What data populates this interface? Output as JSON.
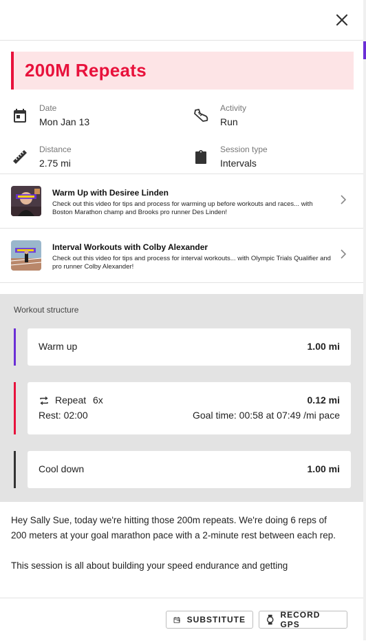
{
  "workout": {
    "title": "200M Repeats"
  },
  "meta": {
    "date": {
      "label": "Date",
      "value": "Mon Jan 13",
      "icon": "calendar-icon"
    },
    "activity": {
      "label": "Activity",
      "value": "Run",
      "icon": "running-shoe-icon"
    },
    "distance": {
      "label": "Distance",
      "value": "2.75 mi",
      "icon": "ruler-icon"
    },
    "session_type": {
      "label": "Session type",
      "value": "Intervals",
      "icon": "clipboard-icon"
    }
  },
  "videos": [
    {
      "title": "Warm Up with Desiree Linden",
      "description": "Check out this video for tips and process for warming up before workouts and races... with Boston Marathon champ and Brooks pro runner Des Linden!"
    },
    {
      "title": "Interval Workouts with Colby Alexander",
      "description": "Check out this video for tips and process for interval workouts... with Olympic Trials Qualifier and pro runner Colby Alexander!"
    }
  ],
  "structure": {
    "label": "Workout structure",
    "warmup": {
      "name": "Warm up",
      "distance": "1.00 mi",
      "color": "#6b2fd6"
    },
    "repeat": {
      "name": "Repeat",
      "count": "6x",
      "distance": "0.12 mi",
      "rest": "Rest: 02:00",
      "goal": "Goal time: 00:58 at 07:49 /mi pace",
      "color": "#e8123c"
    },
    "cooldown": {
      "name": "Cool down",
      "distance": "1.00 mi",
      "color": "#333333"
    }
  },
  "description": {
    "p1": "Hey Sally Sue, today we're hitting those 200m repeats. We're doing 6 reps of 200 meters at your goal marathon pace with a 2-minute rest between each rep.",
    "p2": "This session is all about building your speed endurance and getting"
  },
  "actions": {
    "substitute": "SUBSTITUTE",
    "record_gps": "RECORD GPS"
  },
  "colors": {
    "accent": "#e8123c",
    "accent_bg": "#fde4e6"
  }
}
